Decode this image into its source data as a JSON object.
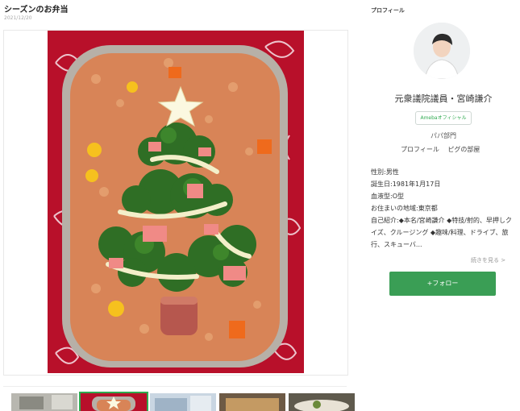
{
  "post": {
    "title": "シーズンのお弁当",
    "date": "2021/12/20"
  },
  "photo": {
    "icon": "bento-photo"
  },
  "thumbnails": [
    {
      "icon": "thumbnail-image",
      "active": false
    },
    {
      "icon": "thumbnail-image",
      "active": true
    },
    {
      "icon": "thumbnail-image",
      "active": false
    },
    {
      "icon": "thumbnail-image",
      "active": false
    },
    {
      "icon": "thumbnail-image",
      "active": false
    }
  ],
  "sidebar": {
    "label": "プロフィール",
    "name": "元衆議院議員・宮崎謙介",
    "badge": "Amebaオフィシャル",
    "papa": "パパ部門",
    "links": [
      "プロフィール",
      "ピグの部屋"
    ],
    "info": [
      "性別:男性",
      "誕生日:1981年1月17日",
      "血液型:O型",
      "お住まいの地域:東京都",
      "自己紹介:◆本名/宮崎謙介 ◆特技/射的、早押しクイズ、クルージング ◆趣味/料理、ドライブ、旅行、スキューバ..."
    ],
    "more": "続きを見る >",
    "follow": "+フォロー"
  },
  "colors": {
    "accent": "#3a9e55",
    "badge_text": "#2eaa4f"
  }
}
